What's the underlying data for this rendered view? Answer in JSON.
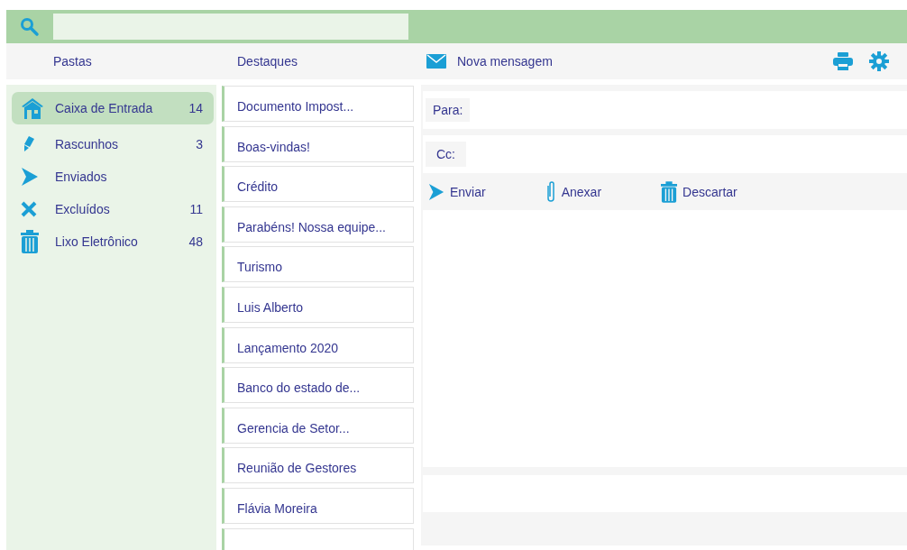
{
  "headers": {
    "folders_title": "Pastas",
    "highlights_title": "Destaques",
    "new_message": "Nova mensagem"
  },
  "folders": [
    {
      "kind": "inbox",
      "label": "Caixa de Entrada",
      "count": "14",
      "selected": true
    },
    {
      "kind": "drafts",
      "label": "Rascunhos",
      "count": "3",
      "selected": false
    },
    {
      "kind": "sent",
      "label": "Enviados",
      "selected": false
    },
    {
      "kind": "deleted",
      "label": "Excluídos",
      "count": "11",
      "selected": false
    },
    {
      "kind": "junk",
      "label": "Lixo Eletrônico",
      "count": "48",
      "selected": false
    }
  ],
  "highlights": [
    "Documento Impost...",
    "Boas-vindas!",
    "Crédito",
    "Parabéns! Nossa equipe...",
    "Turismo",
    "Luis Alberto",
    "Lançamento 2020",
    "Banco do estado de...",
    "Gerencia de Setor...",
    "Reunião de Gestores",
    "Flávia Moreira"
  ],
  "compose": {
    "fields": [
      {
        "label": "Para:"
      },
      {
        "label": "Cc:"
      }
    ],
    "actions": [
      {
        "kind": "send",
        "label": "Enviar"
      },
      {
        "kind": "attach",
        "label": "Anexar"
      },
      {
        "kind": "discard",
        "label": "Descartar"
      }
    ]
  }
}
